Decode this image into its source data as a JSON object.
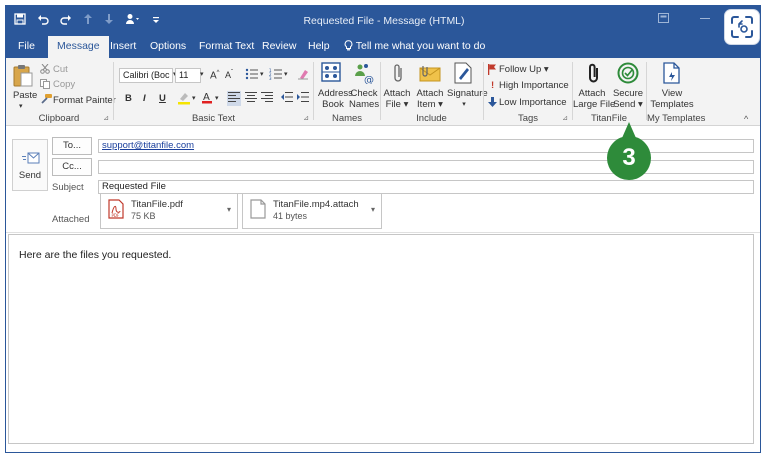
{
  "window": {
    "title": "Requested File  -  Message (HTML)"
  },
  "menu": {
    "tabs": [
      "File",
      "Message",
      "Insert",
      "Options",
      "Format Text",
      "Review",
      "Help"
    ],
    "active_tab": "Message",
    "tell_me": "Tell me what you want to do"
  },
  "ribbon": {
    "clipboard": {
      "paste": "Paste",
      "cut": "Cut",
      "copy": "Copy",
      "format_painter": "Format Painter",
      "label": "Clipboard"
    },
    "basic_text": {
      "font_name": "Calibri (Boc",
      "font_size": "11",
      "bold": "B",
      "italic": "I",
      "underline": "U",
      "label": "Basic Text"
    },
    "names": {
      "address_book_1": "Address",
      "address_book_2": "Book",
      "check_names_1": "Check",
      "check_names_2": "Names",
      "label": "Names"
    },
    "include": {
      "attach_file_1": "Attach",
      "attach_file_2": "File",
      "attach_item_1": "Attach",
      "attach_item_2": "Item",
      "signature": "Signature",
      "label": "Include"
    },
    "tags": {
      "follow_up": "Follow Up",
      "high_importance": "High Importance",
      "low_importance": "Low Importance",
      "label": "Tags"
    },
    "titanfile": {
      "attach_large_1": "Attach",
      "attach_large_2": "Large File",
      "secure_send_1": "Secure",
      "secure_send_2": "Send",
      "label": "TitanFile"
    },
    "my_templates": {
      "view_1": "View",
      "view_2": "Templates",
      "label": "My Templates"
    }
  },
  "callout": {
    "number": "3",
    "color": "#2e8b3a"
  },
  "compose": {
    "send": "Send",
    "to_button": "To...",
    "to_value": "support@titanfile.com",
    "cc_button": "Cc...",
    "cc_value": "",
    "subject_label": "Subject",
    "subject_value": "Requested File",
    "attached_label": "Attached",
    "attachments": [
      {
        "name": "TitanFile.pdf",
        "size": "75 KB",
        "icon": "pdf-icon"
      },
      {
        "name": "TitanFile.mp4.attach",
        "size": "41 bytes",
        "icon": "file-icon"
      }
    ]
  },
  "body": {
    "text": "Here are the files you requested."
  },
  "colors": {
    "brand": "#2b579a",
    "ribbon_bg": "#f3f3f3"
  }
}
